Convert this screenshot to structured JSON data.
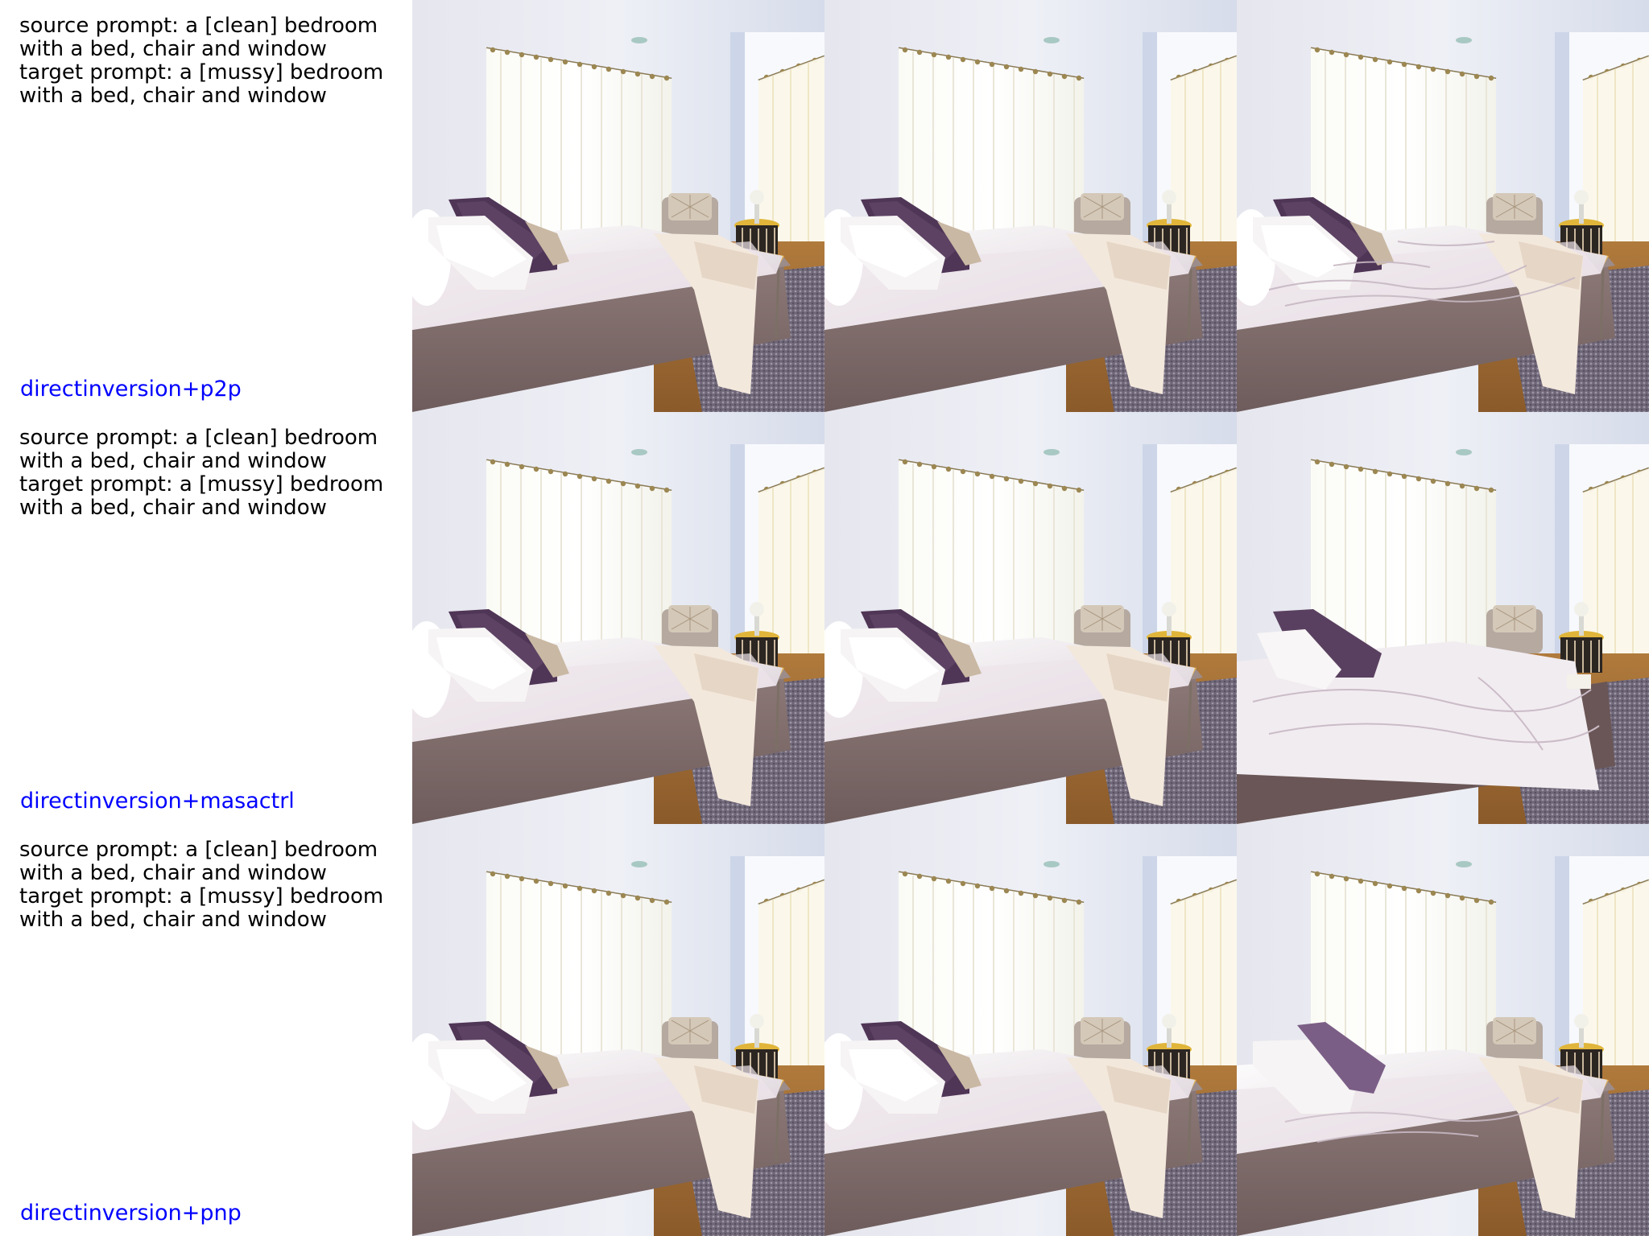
{
  "rows": [
    {
      "source_prompt": "source prompt: a [clean] bedroom\nwith a bed, chair and window",
      "target_prompt": "target prompt: a [mussy] bedroom\nwith a bed, chair and window",
      "method": "directinversion+p2p"
    },
    {
      "source_prompt": "source prompt: a [clean] bedroom\nwith a bed, chair and window",
      "target_prompt": "target prompt: a [mussy] bedroom\nwith a bed, chair and window",
      "method": "directinversion+masactrl"
    },
    {
      "source_prompt": "source prompt: a [clean] bedroom\nwith a bed, chair and window",
      "target_prompt": "target prompt: a [mussy] bedroom\nwith a bed, chair and window",
      "method": "directinversion+pnp"
    }
  ],
  "images": {
    "subject": "bedroom photo with bed, purple pillows, cream throw blanket, armchair, side table and sheer curtained window",
    "colors": {
      "label_text": "#000000",
      "method_text": "#0000ff",
      "background": "#ffffff"
    }
  }
}
